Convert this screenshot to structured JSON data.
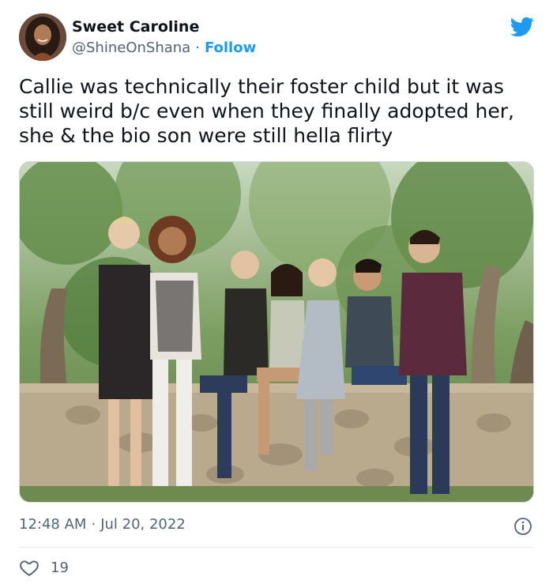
{
  "tweet": {
    "author_name": "Sweet Caroline",
    "handle": "@ShineOnShana",
    "separator": "·",
    "follow_label": "Follow",
    "text": "Callie was technically their foster child but it was still weird b/c even when they finally adopted her, she & the bio son were still hella flirty",
    "time": "12:48 AM",
    "date": "Jul 20, 2022",
    "like_count": "19"
  },
  "icons": {
    "logo": "twitter-bird-icon",
    "info": "info-icon",
    "like": "heart-icon"
  },
  "colors": {
    "accent": "#1d9bf0",
    "text_primary": "#0f1419",
    "text_secondary": "#536471"
  }
}
